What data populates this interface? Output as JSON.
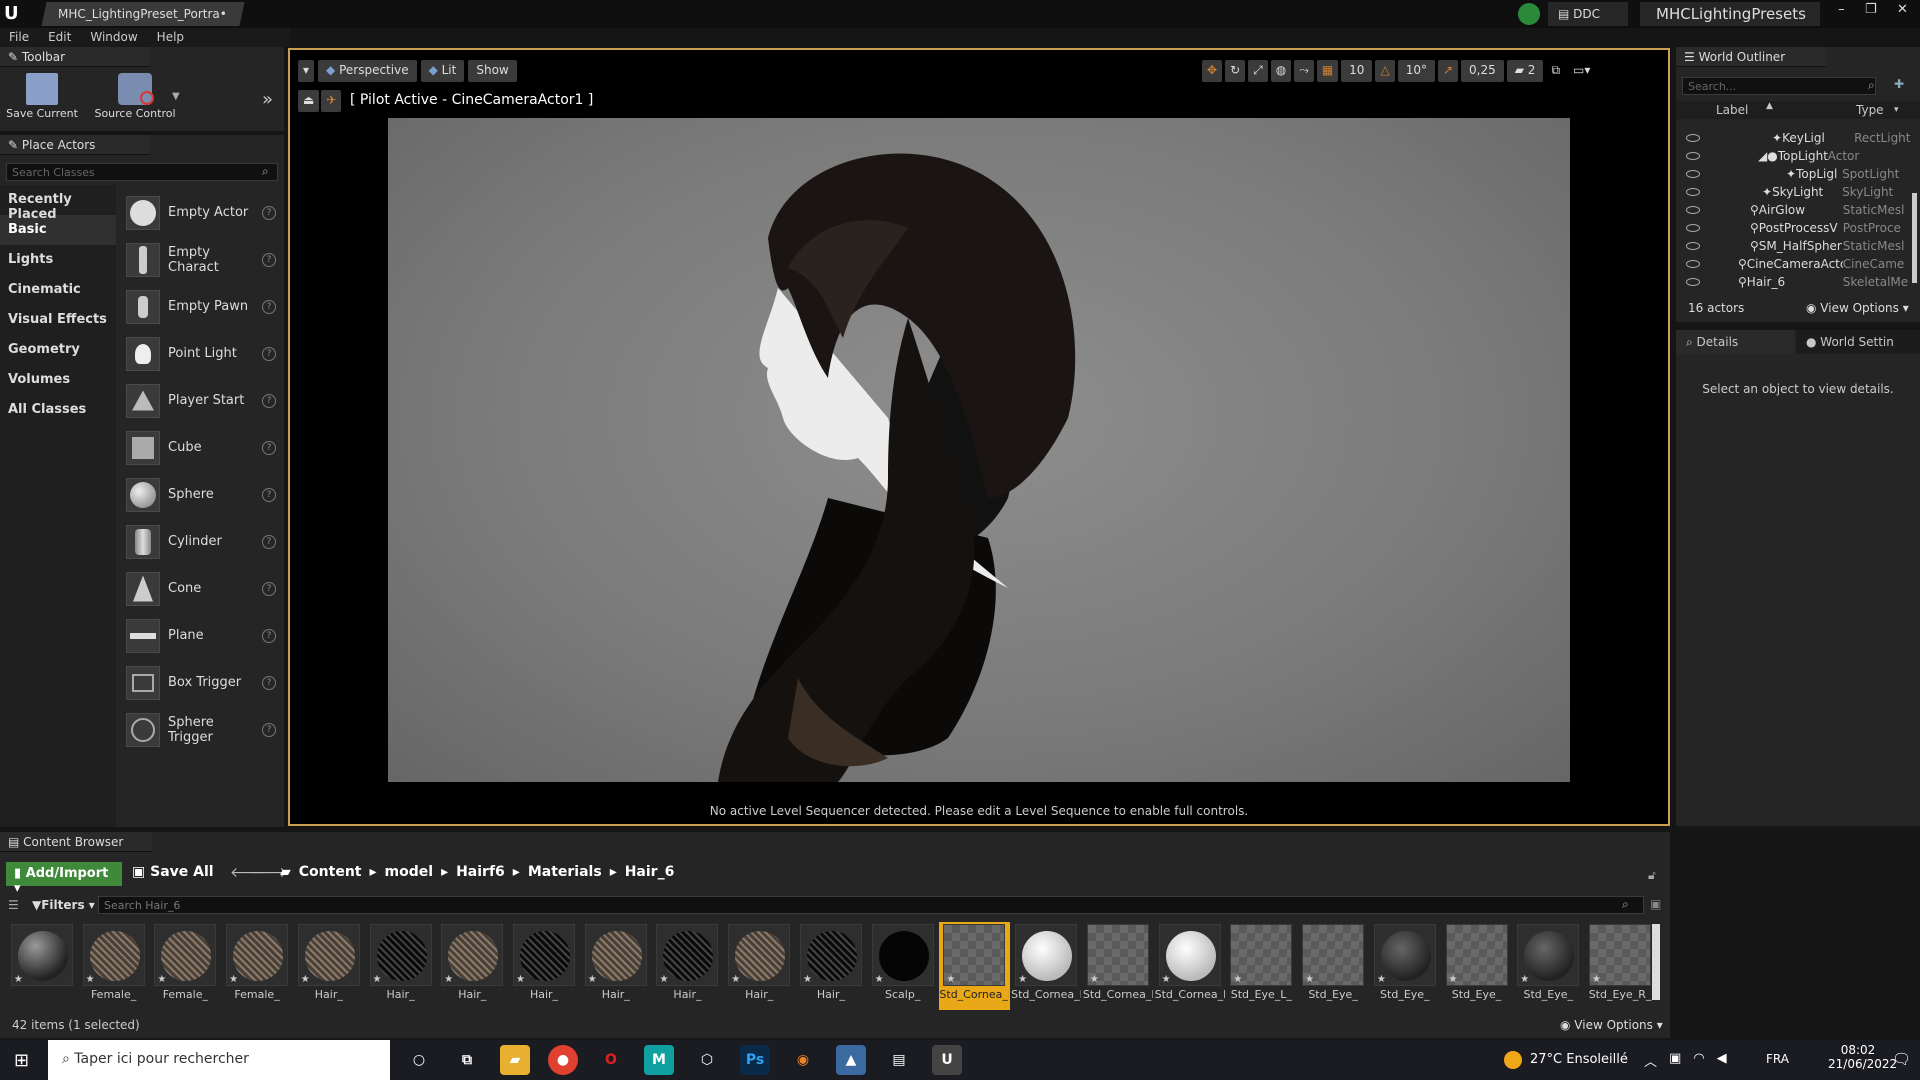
{
  "window": {
    "tab_title": "MHC_LightingPreset_Portra•",
    "ddc_label": "DDC",
    "project_name": "MHCLightingPresets"
  },
  "menu": [
    "File",
    "Edit",
    "Window",
    "Help"
  ],
  "toolbar": {
    "title": "Toolbar",
    "save_current": "Save Current",
    "source_control": "Source Control"
  },
  "place_actors": {
    "title": "Place Actors",
    "search_placeholder": "Search Classes",
    "categories": [
      "Recently Placed",
      "Basic",
      "Lights",
      "Cinematic",
      "Visual Effects",
      "Geometry",
      "Volumes",
      "All Classes"
    ],
    "items": [
      "Empty Actor",
      "Empty Charact",
      "Empty Pawn",
      "Point Light",
      "Player Start",
      "Cube",
      "Sphere",
      "Cylinder",
      "Cone",
      "Plane",
      "Box Trigger",
      "Sphere Trigger"
    ]
  },
  "viewport": {
    "perspective": "Perspective",
    "lit": "Lit",
    "show": "Show",
    "pilot": "[ Pilot Active - CineCameraActor1 ]",
    "grid_snap": "10",
    "rot_snap": "10°",
    "scale_snap": "0,25",
    "cam_speed": "2",
    "status": "No active Level Sequencer detected. Please edit a Level Sequence to enable full controls."
  },
  "outliner": {
    "title": "World Outliner",
    "search_placeholder": "Search...",
    "col_label": "Label",
    "col_type": "Type",
    "rows": [
      {
        "label": "KeyLigl",
        "type": "RectLight",
        "indent": 3
      },
      {
        "label": "TopLight",
        "type": "Actor",
        "indent": 2
      },
      {
        "label": "TopLigl",
        "type": "SpotLight",
        "indent": 3
      },
      {
        "label": "SkyLight",
        "type": "SkyLight",
        "indent": 1
      },
      {
        "label": "AirGlow",
        "type": "StaticMesl",
        "indent": 1
      },
      {
        "label": "PostProcessV",
        "type": "PostProce",
        "indent": 1
      },
      {
        "label": "SM_HalfSpher",
        "type": "StaticMesl",
        "indent": 1
      },
      {
        "label": "CineCameraActc",
        "type": "CineCame",
        "indent": 0
      },
      {
        "label": "Hair_6",
        "type": "SkeletalMe",
        "indent": 0
      }
    ],
    "count": "16 actors",
    "view_options": "View Options"
  },
  "details": {
    "tab1": "Details",
    "tab2": "World Settin",
    "empty_msg": "Select an object to view details."
  },
  "content_browser": {
    "title": "Content Browser",
    "add_import": "Add/Import",
    "save_all": "Save All",
    "breadcrumb": [
      "Content",
      "model",
      "Hairf6",
      "Materials",
      "Hair_6"
    ],
    "filters": "Filters",
    "search_placeholder": "Search Hair_6",
    "assets": [
      {
        "label": "",
        "style": "sphere-dark"
      },
      {
        "label": "Female_",
        "style": "hair-light"
      },
      {
        "label": "Female_",
        "style": "hair-light"
      },
      {
        "label": "Female_",
        "style": "hair-light"
      },
      {
        "label": "Hair_",
        "style": "hair-light"
      },
      {
        "label": "Hair_",
        "style": "hair-dark"
      },
      {
        "label": "Hair_",
        "style": "hair-light"
      },
      {
        "label": "Hair_",
        "style": "hair-dark"
      },
      {
        "label": "Hair_",
        "style": "hair-light"
      },
      {
        "label": "Hair_",
        "style": "hair-dark"
      },
      {
        "label": "Hair_",
        "style": "hair-light"
      },
      {
        "label": "Hair_",
        "style": "hair-dark"
      },
      {
        "label": "Scalp_",
        "style": "black"
      },
      {
        "label": "Std_Cornea_L",
        "style": "checker",
        "selected": true
      },
      {
        "label": "Std_Cornea_L",
        "style": "sphere-white"
      },
      {
        "label": "Std_Cornea_R",
        "style": "checker"
      },
      {
        "label": "Std_Cornea_R",
        "style": "sphere-white"
      },
      {
        "label": "Std_Eye_L_",
        "style": "checker"
      },
      {
        "label": "Std_Eye_",
        "style": "checker"
      },
      {
        "label": "Std_Eye_",
        "style": "sphere-grey"
      },
      {
        "label": "Std_Eye_",
        "style": "checker"
      },
      {
        "label": "Std_Eye_",
        "style": "sphere-grey"
      },
      {
        "label": "Std_Eye_R_",
        "style": "checker"
      }
    ],
    "item_count": "42 items (1 selected)",
    "view_options": "View Options"
  },
  "taskbar": {
    "search_placeholder": "Taper ici pour rechercher",
    "weather": "27°C Ensoleillé",
    "lang": "FRA",
    "time": "08:02",
    "date": "21/06/2022"
  }
}
